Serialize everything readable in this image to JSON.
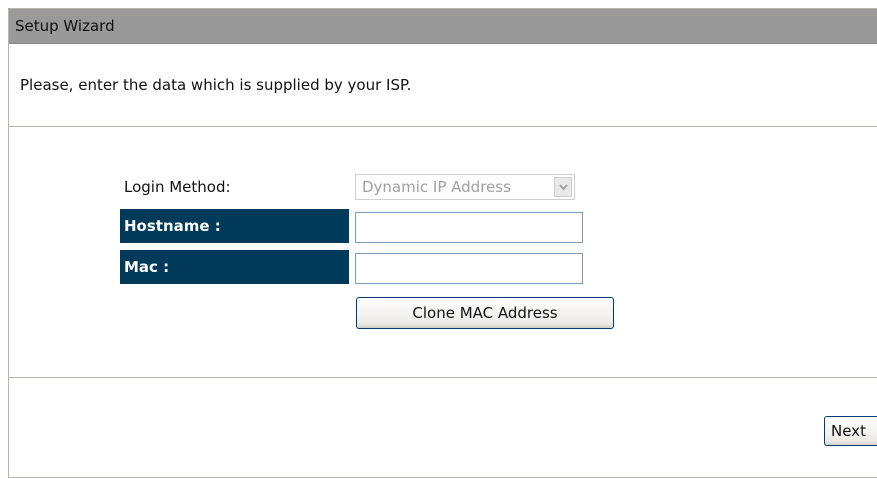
{
  "wizard": {
    "title": "Setup Wizard",
    "instruction": "Please, enter the data which is supplied by your ISP."
  },
  "form": {
    "login_method_label": "Login Method:",
    "login_method_value": "Dynamic IP Address",
    "hostname_label": "Hostname :",
    "hostname_value": "",
    "mac_label": "Mac :",
    "mac_value": "",
    "clone_button": "Clone MAC Address"
  },
  "footer": {
    "next_button": "Next"
  },
  "colors": {
    "title_bar": "#999999",
    "label_dark": "#003a5a"
  },
  "icons": {
    "select_arrow": "chevron-down-icon"
  }
}
